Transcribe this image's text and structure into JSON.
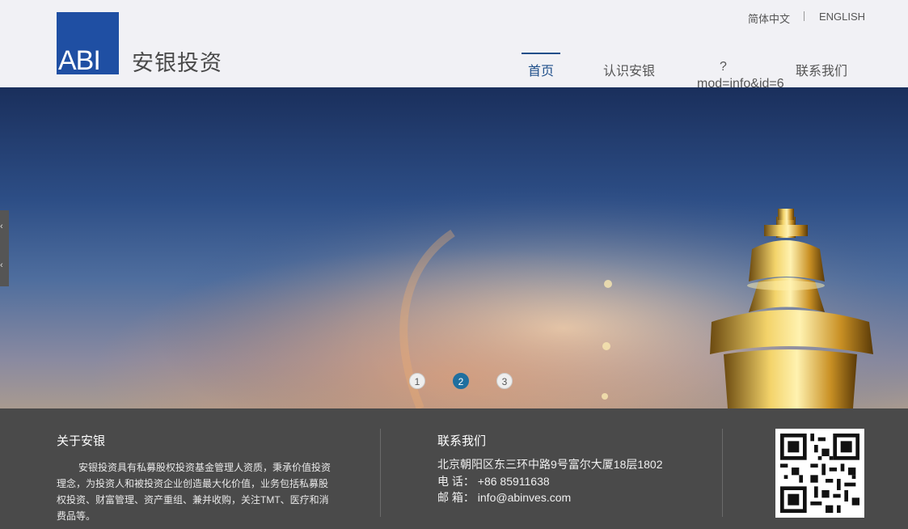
{
  "header": {
    "logo_text": "ABI",
    "brand_name": "安银投资",
    "lang": {
      "cn": "简体中文",
      "en": "ENGLISH"
    },
    "nav": {
      "home": "首页",
      "about": "认识安银",
      "broken_q": "?",
      "broken_mod": "mod=info&id=6",
      "contact": "联系我们"
    }
  },
  "banner": {
    "side_arrows": [
      "‹",
      "‹"
    ],
    "slides": [
      "1",
      "2",
      "3"
    ],
    "active_slide": 2
  },
  "footer": {
    "about_title": "关于安银",
    "about_text": "安银投资具有私募股权投资基金管理人资质，秉承价值投资理念，为投资人和被投资企业创造最大化价值，业务包括私募股权投资、财富管理、资产重组、兼并收购，关注TMT、医疗和消费品等。",
    "contact_title": "联系我们",
    "address": "北京朝阳区东三环中路9号富尔大厦18层1802",
    "phone": "电 话： +86 85911638",
    "email": "邮 箱： info@abinves.com"
  }
}
